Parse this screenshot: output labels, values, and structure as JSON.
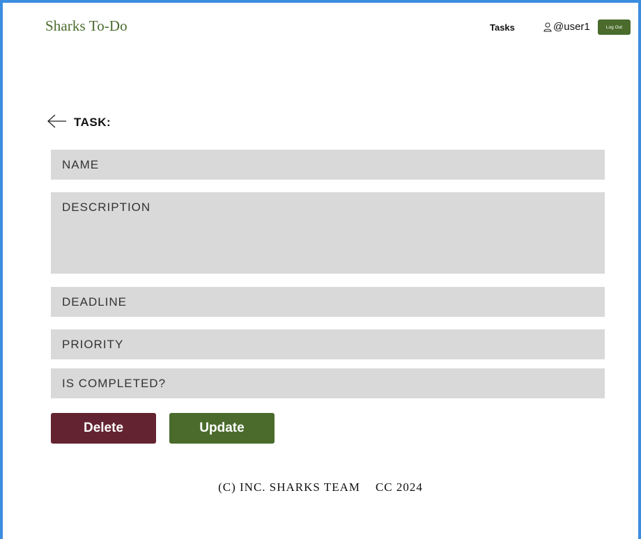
{
  "header": {
    "brand": "Sharks To-Do",
    "nav_tasks": "Tasks",
    "username": "@user1",
    "logout_label": "Log Out"
  },
  "task": {
    "title": "TASK:",
    "fields": {
      "name_placeholder": "NAME",
      "description_placeholder": "DESCRIPTION",
      "deadline_placeholder": "DEADLINE",
      "priority_placeholder": "PRIORITY",
      "completed_placeholder": "IS COMPLETED?"
    },
    "delete_label": "Delete",
    "update_label": "Update"
  },
  "footer": {
    "left": "(C) INC. SHARKS TEAM",
    "right": "CC 2024"
  },
  "colors": {
    "brand_green": "#4a6b2c",
    "delete_maroon": "#632331",
    "field_gray": "#d9d9d9",
    "frame_blue": "#3b8de0"
  },
  "icons": {
    "back": "arrow-left-icon",
    "user": "user-icon"
  }
}
